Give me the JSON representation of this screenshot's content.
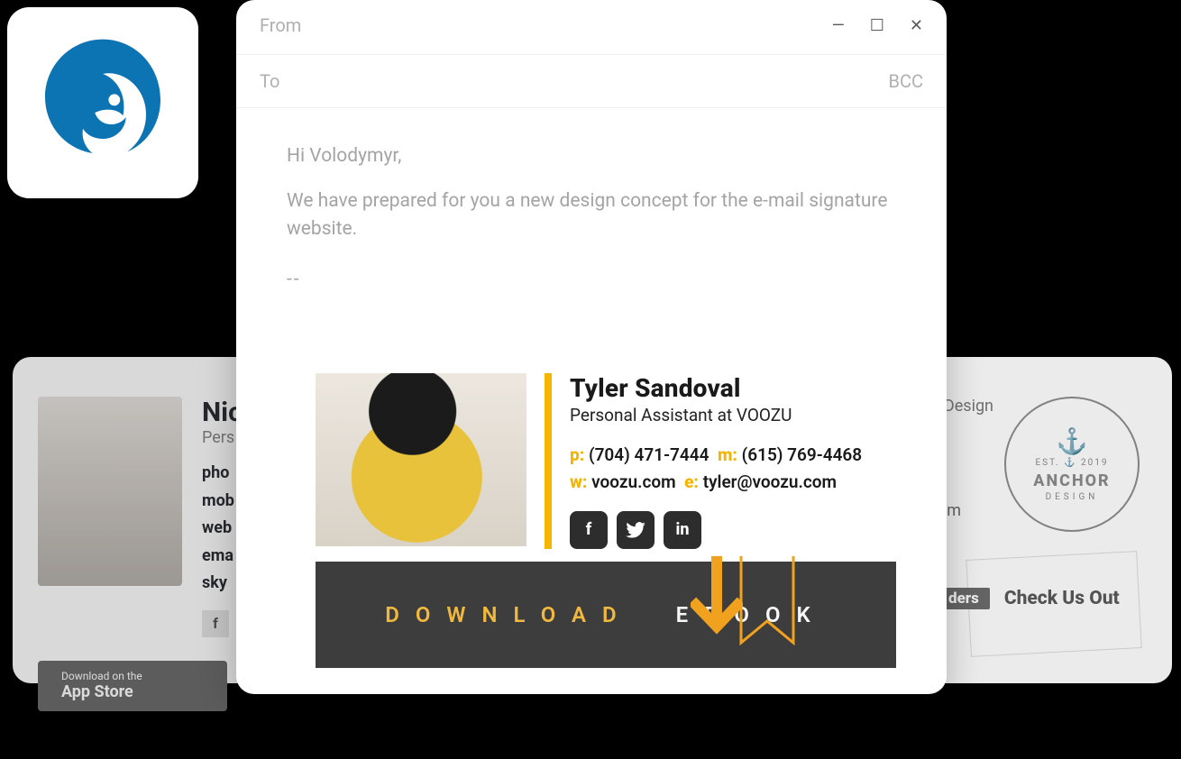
{
  "compose": {
    "from_label": "From",
    "to_label": "To",
    "bcc_label": "BCC",
    "greeting": "Hi Volodymyr,",
    "body_line": "We have prepared for you a new design concept for the e-mail signature website.",
    "sig_sep": "--"
  },
  "signature": {
    "name": "Tyler Sandoval",
    "title": "Personal Assistant at VOOZU",
    "labels": {
      "p": "p:",
      "m": "m:",
      "w": "w:",
      "e": "e:"
    },
    "phone": "(704) 471-7444",
    "mobile": "(615) 769-4468",
    "website": "voozu.com",
    "email": "tyler@voozu.com",
    "social_glyphs": {
      "fb": "f",
      "tw": "",
      "in": "in"
    }
  },
  "banner": {
    "word1": "DOWNLOAD",
    "word2": "EBOOK"
  },
  "card_left": {
    "name": "Nic",
    "title": "Pers",
    "lines": [
      "pho",
      "mob",
      "web",
      "ema",
      "sky"
    ],
    "appstore_l1": "Download on the",
    "appstore_l2": "App Store"
  },
  "card_right": {
    "topline": "Design",
    "om": "om",
    "brand": "ANCHOR",
    "sub": "DESIGN",
    "est": "EST.  ⚓  2019",
    "pill": "ders",
    "pill2": "Check Us Out"
  }
}
